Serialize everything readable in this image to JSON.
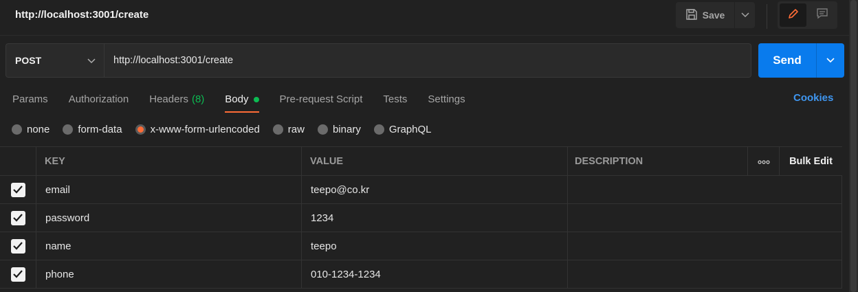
{
  "header": {
    "request_title": "http://localhost:3001/create",
    "save_label": "Save"
  },
  "request": {
    "method": "POST",
    "url": "http://localhost:3001/create",
    "send_label": "Send"
  },
  "tabs": [
    {
      "label": "Params"
    },
    {
      "label": "Authorization"
    },
    {
      "label": "Headers",
      "count": "(8)"
    },
    {
      "label": "Body",
      "active": true
    },
    {
      "label": "Pre-request Script"
    },
    {
      "label": "Tests"
    },
    {
      "label": "Settings"
    }
  ],
  "cookies_label": "Cookies",
  "body_types": [
    {
      "label": "none"
    },
    {
      "label": "form-data"
    },
    {
      "label": "x-www-form-urlencoded",
      "selected": true
    },
    {
      "label": "raw"
    },
    {
      "label": "binary"
    },
    {
      "label": "GraphQL"
    }
  ],
  "table": {
    "headers": {
      "key": "KEY",
      "value": "VALUE",
      "description": "DESCRIPTION",
      "more": "ooo",
      "bulk_edit": "Bulk Edit"
    },
    "rows": [
      {
        "key": "email",
        "value": "teepo@co.kr",
        "description": "",
        "checked": true
      },
      {
        "key": "password",
        "value": "1234",
        "description": "",
        "checked": true
      },
      {
        "key": "name",
        "value": "teepo",
        "description": "",
        "checked": true
      },
      {
        "key": "phone",
        "value": "010-1234-1234",
        "description": "",
        "checked": true
      }
    ]
  },
  "colors": {
    "accent": "#ff6c37",
    "send": "#097bed",
    "status_green": "#0cbb52",
    "link_blue": "#3f96f0",
    "background": "#212121"
  }
}
